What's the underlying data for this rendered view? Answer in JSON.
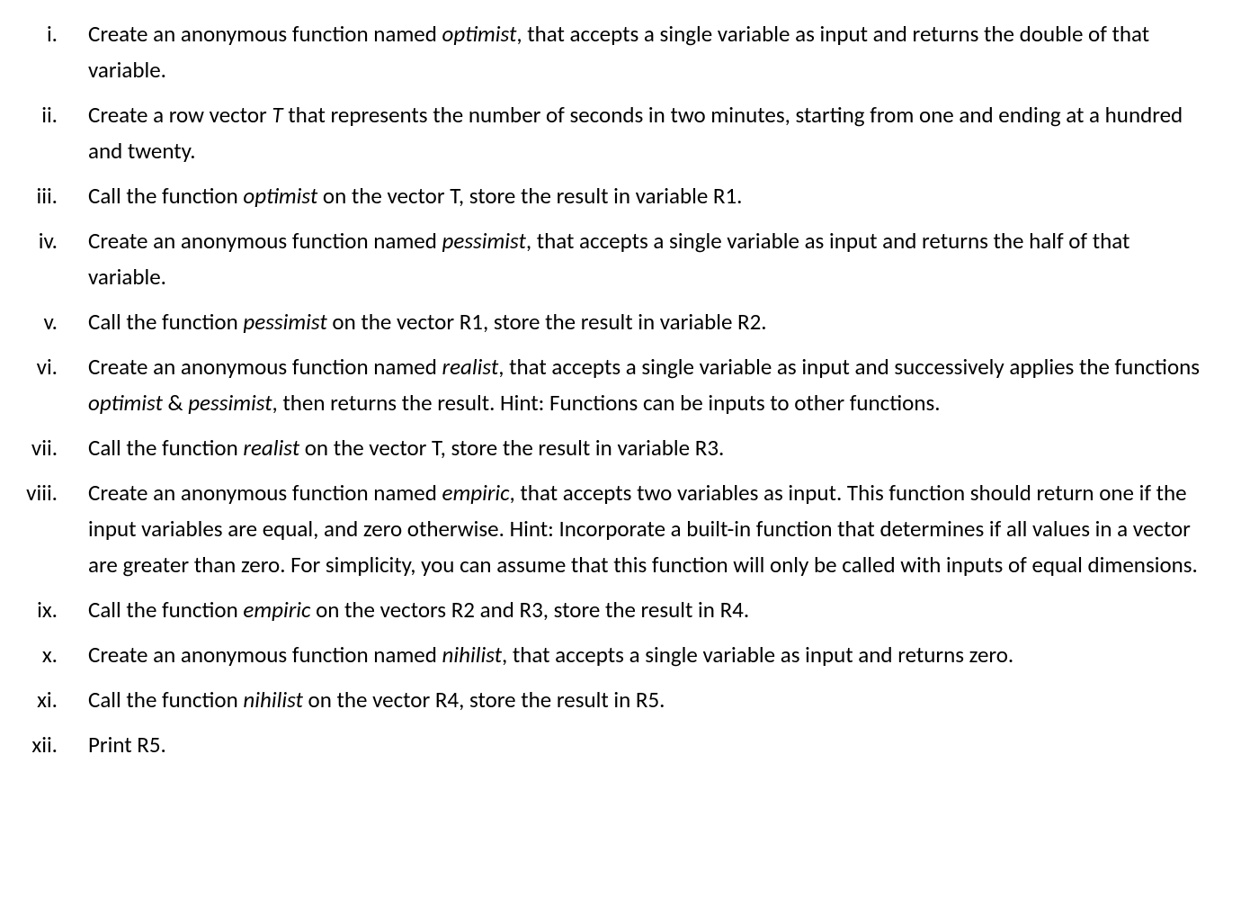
{
  "items": [
    {
      "num": "i.",
      "segments": [
        {
          "t": "Create an anonymous function named "
        },
        {
          "t": "optimist",
          "i": true
        },
        {
          "t": ", that accepts a single variable as input and returns the double of that variable."
        }
      ]
    },
    {
      "num": "ii.",
      "segments": [
        {
          "t": "Create a row vector "
        },
        {
          "t": "T",
          "i": true
        },
        {
          "t": " that represents the number of seconds in two minutes, starting from one and ending at a hundred and twenty."
        }
      ]
    },
    {
      "num": "iii.",
      "segments": [
        {
          "t": "Call the function "
        },
        {
          "t": "optimist",
          "i": true
        },
        {
          "t": " on the vector T, store the result in variable R1."
        }
      ]
    },
    {
      "num": "iv.",
      "segments": [
        {
          "t": "Create an anonymous function named "
        },
        {
          "t": "pessimist",
          "i": true
        },
        {
          "t": ", that accepts a single variable as input and returns the half of that variable."
        }
      ]
    },
    {
      "num": "v.",
      "segments": [
        {
          "t": "Call the function "
        },
        {
          "t": "pessimist",
          "i": true
        },
        {
          "t": " on the vector R1, store the result in variable R2."
        }
      ]
    },
    {
      "num": "vi.",
      "segments": [
        {
          "t": "Create an anonymous function named "
        },
        {
          "t": "realist",
          "i": true
        },
        {
          "t": ", that accepts a single variable as input and successively applies the functions "
        },
        {
          "t": "optimist",
          "i": true
        },
        {
          "t": " & "
        },
        {
          "t": "pessimist",
          "i": true
        },
        {
          "t": ", then returns the result. Hint: Functions can be inputs to other functions."
        }
      ]
    },
    {
      "num": "vii.",
      "segments": [
        {
          "t": "Call the function "
        },
        {
          "t": "realist",
          "i": true
        },
        {
          "t": " on the vector T, store the result in variable R3."
        }
      ]
    },
    {
      "num": "viii.",
      "segments": [
        {
          "t": "Create an anonymous function named "
        },
        {
          "t": "empiric",
          "i": true
        },
        {
          "t": ", that accepts two variables as input. This function should return one if the input variables are equal, and zero otherwise. Hint: Incorporate a built-in function that determines if all values in a vector are greater than zero. For simplicity, you can assume that this function will only be called with inputs of equal dimensions."
        }
      ]
    },
    {
      "num": "ix.",
      "segments": [
        {
          "t": "Call the function "
        },
        {
          "t": "empiric",
          "i": true
        },
        {
          "t": " on the vectors R2 and R3, store the result in R4."
        }
      ]
    },
    {
      "num": "x.",
      "segments": [
        {
          "t": "Create an anonymous function named "
        },
        {
          "t": "nihilist",
          "i": true
        },
        {
          "t": ", that accepts a single variable as input and returns zero."
        }
      ]
    },
    {
      "num": "xi.",
      "segments": [
        {
          "t": "Call the function "
        },
        {
          "t": "nihilist",
          "i": true
        },
        {
          "t": " on the vector R4, store the result in R5."
        }
      ]
    },
    {
      "num": "xii.",
      "segments": [
        {
          "t": "Print R5."
        }
      ]
    }
  ]
}
